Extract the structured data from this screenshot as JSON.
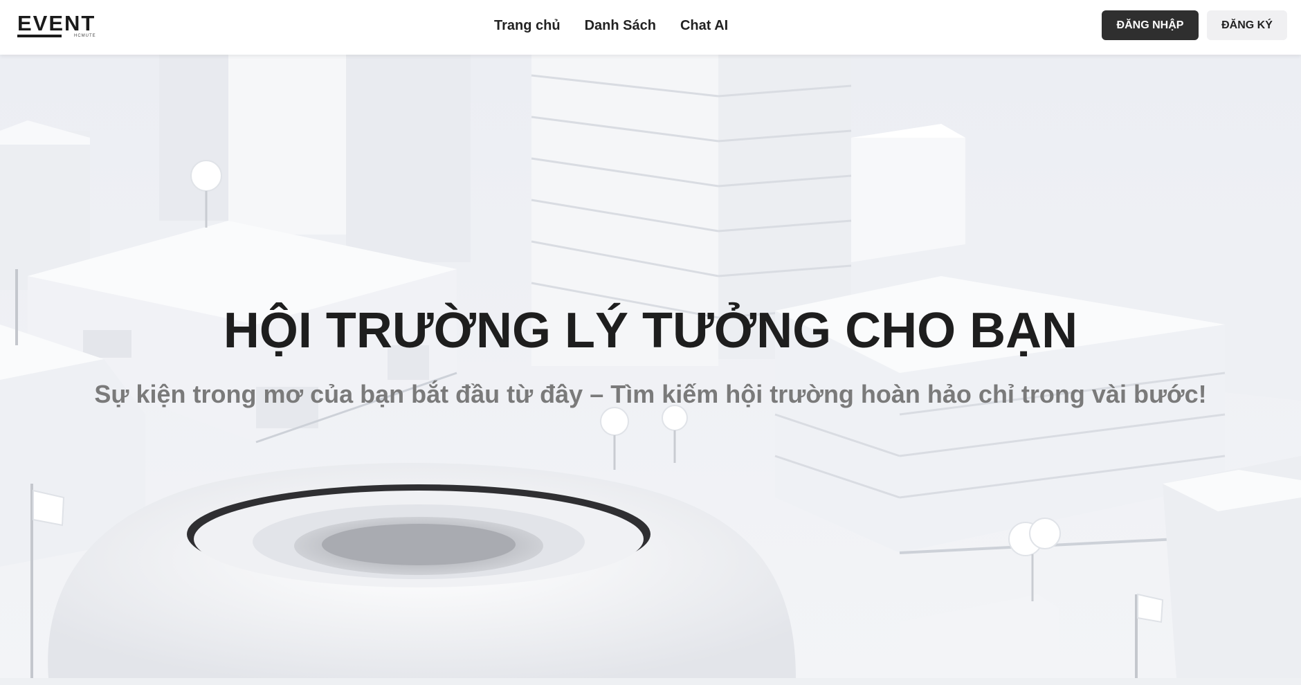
{
  "header": {
    "logo": {
      "text": "EVENT",
      "subtext": "HCMUTE"
    },
    "nav": [
      {
        "label": "Trang chủ"
      },
      {
        "label": "Danh Sách"
      },
      {
        "label": "Chat AI"
      }
    ],
    "login_label": "ĐĂNG NHẬP",
    "register_label": "ĐĂNG KÝ"
  },
  "hero": {
    "title": "HỘI TRƯỜNG LÝ TƯỞNG CHO BẠN",
    "subtitle": "Sự kiện trong mơ của bạn bắt đầu từ đây – Tìm kiếm hội trường hoàn hảo chỉ trong vài bước!",
    "background_icon": "city-illustration"
  },
  "colors": {
    "primary_button": "#2f2f2f",
    "secondary_button": "#f0f0f2",
    "title": "#1e1e1e",
    "subtitle": "#7a7a7a"
  }
}
